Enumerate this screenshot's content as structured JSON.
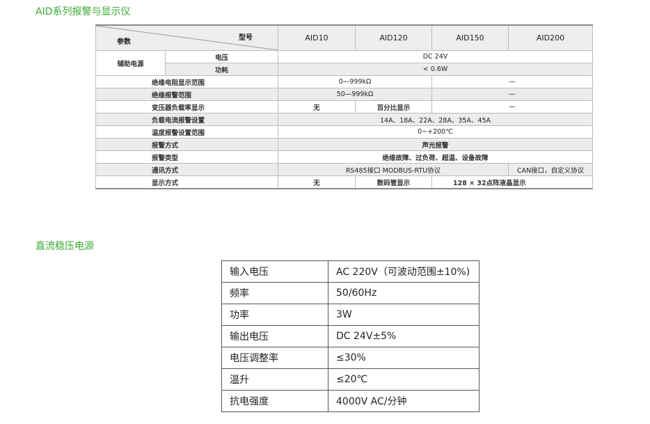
{
  "sections": {
    "aid_title": "AID系列报警与显示仪",
    "power_title": "直流稳压电源"
  },
  "spec_table": {
    "corner_model": "型号",
    "corner_param": "参数",
    "models": [
      "AID10",
      "AID120",
      "AID150",
      "AID200"
    ],
    "aux_power": {
      "label": "辅助电源",
      "voltage_label": "电压",
      "voltage_value": "DC 24V",
      "power_label": "功耗",
      "power_value": "< 0.6W"
    },
    "insulation_range": {
      "label": "绝缘电阻显示范围",
      "value": "0—999kΩ",
      "aid200": "—"
    },
    "alarm_range": {
      "label": "绝缘报警范围",
      "value": "50—999kΩ",
      "aid200": "—"
    },
    "load_rate": {
      "label": "变压器负载率显示",
      "aid10": "无",
      "aid120": "百分比显示",
      "aid150_200": "—"
    },
    "current_alarm": {
      "label": "负载电流报警设置",
      "value": "14A、18A、22A、28A、35A、45A"
    },
    "temp_alarm": {
      "label": "温度报警设置范围",
      "value": "0~+200℃"
    },
    "alarm_mode": {
      "label": "报警方式",
      "value": "声光报警"
    },
    "alarm_type": {
      "label": "报警类型",
      "value": "绝缘故障、过负荷、超温、设备故障"
    },
    "comm_mode": {
      "label": "通讯方式",
      "value": "RS485接口 MODBUS-RTU协议",
      "aid200": "CAN接口，自定义协议"
    },
    "display_mode": {
      "label": "显示方式",
      "aid10": "无",
      "aid120": "数码管显示",
      "aid150_200": "128 × 32点阵液晶显示"
    }
  },
  "power_table": {
    "rows": [
      {
        "label": "输入电压",
        "value": "AC 220V（可波动范围±10%)"
      },
      {
        "label": "频率",
        "value": "50/60Hz"
      },
      {
        "label": "功率",
        "value": "3W"
      },
      {
        "label": "输出电压",
        "value": "DC 24V±5%"
      },
      {
        "label": "电压调整率",
        "value": "≤30%"
      },
      {
        "label": "温升",
        "value": "≤20℃"
      },
      {
        "label": "抗电强度",
        "value": "4000V AC/分钟"
      }
    ]
  },
  "colors": {
    "section_title": "#3aaa35",
    "shaded_row": "#ececec",
    "border": "#bdbdbd"
  }
}
